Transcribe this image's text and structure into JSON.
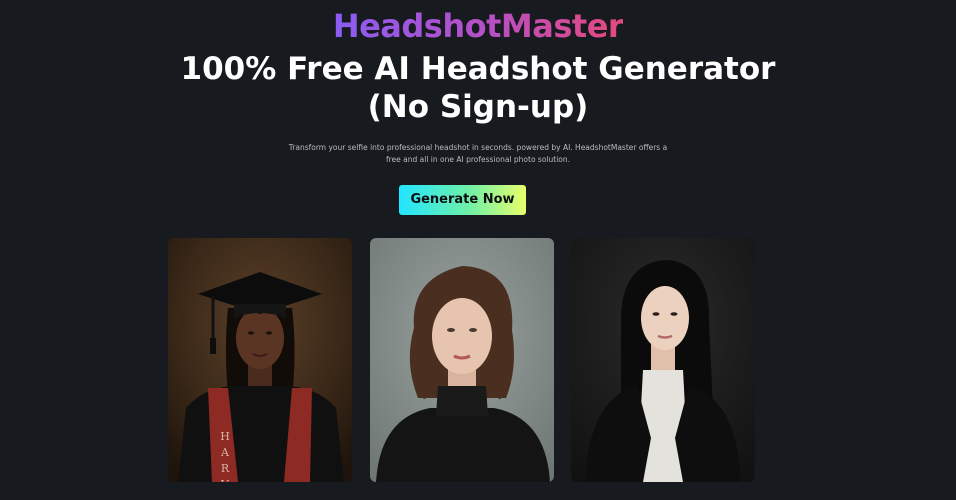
{
  "brand": {
    "name": "HeadshotMaster"
  },
  "hero": {
    "title_line1": "100% Free AI Headshot Generator",
    "title_line2": "(No Sign-up)",
    "subtitle_line1": "Transform your selfie into professional headshot in seconds. powered by AI. HeadshotMaster offers a",
    "subtitle_line2": "free and all in one AI professional photo solution.",
    "cta_label": "Generate Now"
  },
  "gallery": {
    "items": [
      {
        "name": "graduate-headshot",
        "sash_text": "HARV"
      },
      {
        "name": "woman-turtleneck-headshot"
      },
      {
        "name": "woman-blazer-headshot"
      }
    ]
  },
  "colors": {
    "background": "#171a1f",
    "brand_gradient": [
      "#8b5cf6",
      "#e6497b"
    ],
    "cta_gradient": [
      "#22e5ff",
      "#e8ff6a"
    ]
  }
}
